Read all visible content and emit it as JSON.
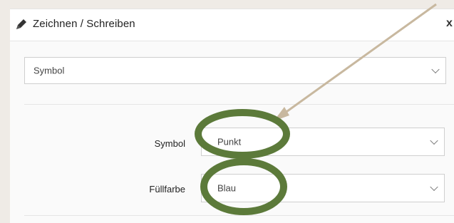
{
  "dialog": {
    "title": "Zeichnen / Schreiben",
    "close_label": "x"
  },
  "mode_select": {
    "value": "Symbol"
  },
  "fields": [
    {
      "label": "Symbol",
      "value": "Punkt"
    },
    {
      "label": "Füllfarbe",
      "value": "Blau"
    }
  ],
  "annotation": {
    "arrow_color": "#c8b89f",
    "oval_color": "#5c7a3a"
  }
}
